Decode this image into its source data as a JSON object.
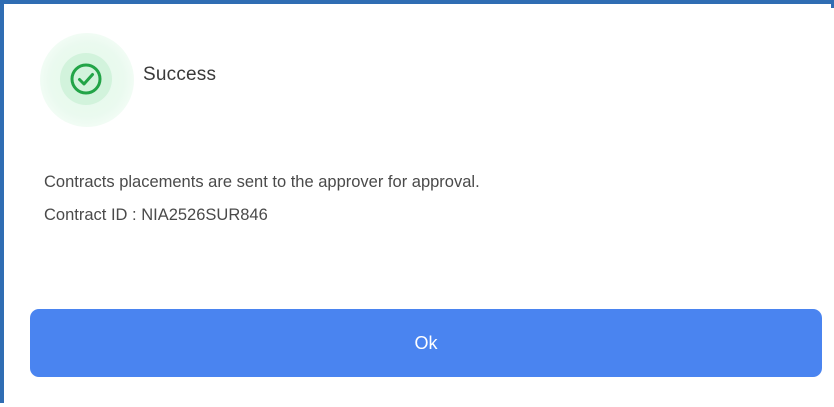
{
  "dialog": {
    "icon": "check-circle-icon",
    "title": "Success",
    "message_line1": "Contracts placements are sent to the approver for approval.",
    "message_line2": "Contract ID : NIA2526SUR846",
    "ok_label": "Ok"
  },
  "colors": {
    "accent": "#4a84f0",
    "success": "#22a447",
    "frame": "#2f6db3"
  }
}
